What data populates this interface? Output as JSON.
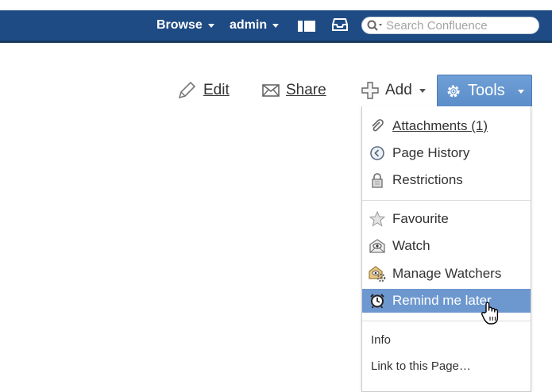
{
  "header": {
    "browse_label": "Browse",
    "admin_label": "admin",
    "search_placeholder": "Search Confluence",
    "bar_color": "#1e4b84"
  },
  "actions": {
    "edit_label": "Edit",
    "share_label": "Share",
    "add_label": "Add",
    "tools_label": "Tools",
    "tools_color": "#6f9fd6"
  },
  "tools_menu": {
    "items": [
      {
        "label": "Attachments (1)",
        "icon": "paperclip-icon"
      },
      {
        "label": "Page History",
        "icon": "history-icon"
      },
      {
        "label": "Restrictions",
        "icon": "lock-icon"
      },
      {
        "label": "Favourite",
        "icon": "star-icon"
      },
      {
        "label": "Watch",
        "icon": "watch-envelope-icon"
      },
      {
        "label": "Manage Watchers",
        "icon": "manage-watchers-icon"
      },
      {
        "label": "Remind me later",
        "icon": "alarm-clock-icon",
        "highlighted": true
      },
      {
        "label": "Info"
      },
      {
        "label": "Link to this Page…"
      }
    ],
    "highlight_color": "#6d98cf"
  }
}
